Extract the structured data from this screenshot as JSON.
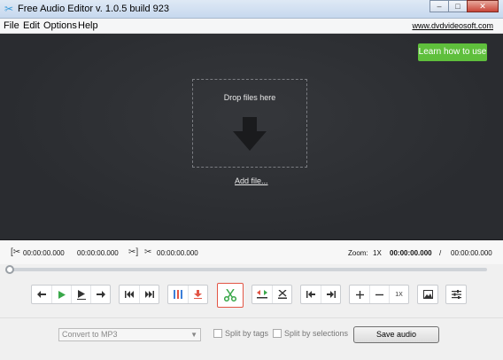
{
  "window": {
    "title": "Free Audio Editor v. 1.0.5 build 923",
    "minimize_label": "0",
    "maximize_label": "1",
    "close_label": "✕"
  },
  "menu": {
    "items": [
      "File",
      "Edit",
      "Options",
      "Help"
    ],
    "site_link": "www.dvdvideosoft.com"
  },
  "editor": {
    "learn_button": "Learn how to use",
    "drop_text": "Drop files here",
    "add_file_link": "Add file..."
  },
  "timeline": {
    "selection_start": "00:00:00.000",
    "selection_end": "00:00:00.000",
    "cut_time": "00:00:00.000",
    "zoom_label": "Zoom:",
    "zoom_value": "1X",
    "current_time": "00:00:00.000",
    "separator": "/",
    "total_time": "00:00:00.000",
    "position": 0
  },
  "toolbar": {
    "groups": [
      [
        "rewind-icon",
        "play-icon",
        "play-selection-icon",
        "forward-icon"
      ],
      [
        "skip-start-icon",
        "skip-end-icon"
      ],
      [
        "split-markers-icon",
        "download-icon"
      ],
      [
        "cut-scissors-icon"
      ],
      [
        "insert-silence-icon",
        "delete-selection-icon"
      ],
      [
        "go-to-start-icon",
        "go-to-end-icon"
      ],
      [
        "zoom-in-icon",
        "zoom-out-icon",
        "zoom-reset-icon"
      ],
      [
        "image-icon"
      ],
      [
        "settings-icon"
      ]
    ],
    "zoom_reset_label": "1X",
    "accent_color": "#5fbf3c",
    "cut_border_color": "#e25545"
  },
  "bottom": {
    "format_select": "Convert to MP3",
    "split_by_tags": "Split by tags",
    "split_by_selections": "Split by selections",
    "save_button": "Save audio"
  }
}
